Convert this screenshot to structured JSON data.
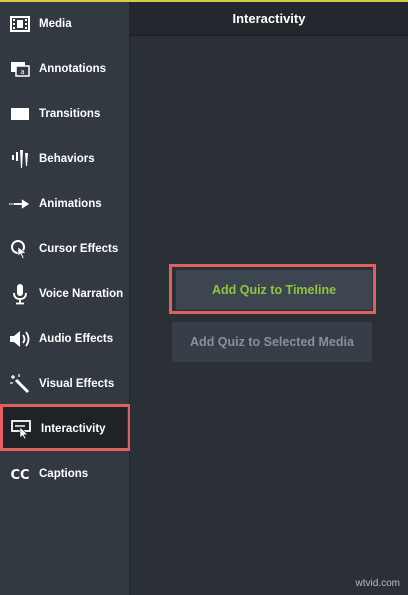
{
  "header": {
    "title": "Interactivity"
  },
  "sidebar": {
    "items": [
      {
        "label": "Media",
        "icon": "film-icon"
      },
      {
        "label": "Annotations",
        "icon": "annotation-icon"
      },
      {
        "label": "Transitions",
        "icon": "transition-icon"
      },
      {
        "label": "Behaviors",
        "icon": "behaviors-icon"
      },
      {
        "label": "Animations",
        "icon": "animation-arrow-icon"
      },
      {
        "label": "Cursor Effects",
        "icon": "cursor-effects-icon"
      },
      {
        "label": "Voice Narration",
        "icon": "microphone-icon"
      },
      {
        "label": "Audio Effects",
        "icon": "speaker-icon"
      },
      {
        "label": "Visual Effects",
        "icon": "magic-wand-icon"
      },
      {
        "label": "Interactivity",
        "icon": "interactivity-icon",
        "active": true
      },
      {
        "label": "Captions",
        "icon": "captions-icon"
      }
    ]
  },
  "main": {
    "add_quiz_timeline_label": "Add Quiz to Timeline",
    "add_quiz_media_label": "Add Quiz to Selected Media"
  },
  "watermark": "wtvid.com",
  "colors": {
    "accent_green": "#8dc63f",
    "highlight_red": "#e06060",
    "top_line": "#d8c94a"
  }
}
